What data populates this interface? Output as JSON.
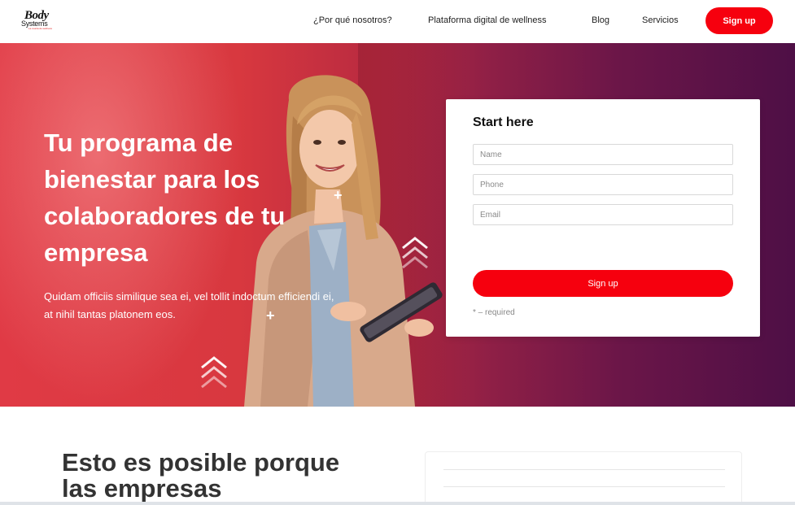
{
  "brand": {
    "logo_main": "Body",
    "logo_sub": "Systems",
    "logo_tagline": "La cuarta de wellness"
  },
  "nav": {
    "items": [
      {
        "label": "¿Por qué nosotros?"
      },
      {
        "label": "Plataforma digital de wellness"
      },
      {
        "label": "Blog"
      },
      {
        "label": "Servicios"
      }
    ],
    "signup_label": "Sign up"
  },
  "hero": {
    "title": "Tu programa de bienestar para los colaboradores de tu empresa",
    "subtitle": "Quidam officiis similique sea ei, vel tollit indoctum efficiendi ei, at nihil tantas platonem eos."
  },
  "form": {
    "title": "Start here",
    "fields": [
      {
        "placeholder": "Name",
        "value": ""
      },
      {
        "placeholder": "Phone",
        "value": ""
      },
      {
        "placeholder": "Email",
        "value": ""
      }
    ],
    "submit_label": "Sign up",
    "required_note": "* – required"
  },
  "section2": {
    "title": "Esto es posible porque las empresas"
  },
  "colors": {
    "accent": "#f6000e",
    "hero_left": "#e03a45",
    "hero_right": "#4e0f46"
  }
}
